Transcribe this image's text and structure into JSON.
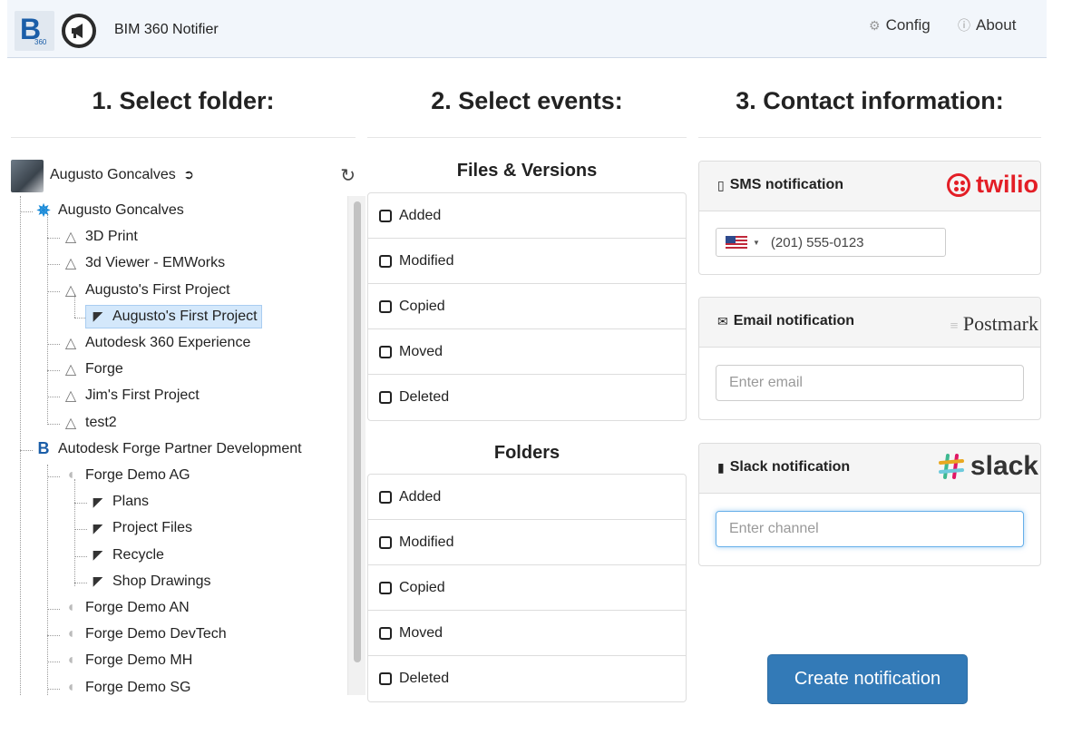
{
  "app": {
    "title": "BIM 360 Notifier",
    "logo_text": "B",
    "logo_sub": "360",
    "logo_icon": "megaphone-icon"
  },
  "nav": {
    "config_label": "Config",
    "about_label": "About"
  },
  "columns": {
    "folder_title": "1. Select folder:",
    "events_title": "2. Select events:",
    "contact_title": "3. Contact information:"
  },
  "user": {
    "name": "Augusto Goncalves"
  },
  "tree": {
    "items": [
      {
        "label": "Augusto Goncalves",
        "icon": "hub-icon",
        "level": 0
      },
      {
        "label": "3D Print",
        "icon": "project-icon",
        "level": 1
      },
      {
        "label": "3d Viewer - EMWorks",
        "icon": "project-icon",
        "level": 1
      },
      {
        "label": "Augusto's First Project",
        "icon": "project-icon",
        "level": 1
      },
      {
        "label": "Augusto's First Project",
        "icon": "folder-open-icon",
        "level": 2,
        "selected": true
      },
      {
        "label": "Autodesk 360 Experience",
        "icon": "project-icon",
        "level": 1
      },
      {
        "label": "Forge",
        "icon": "project-icon",
        "level": 1
      },
      {
        "label": "Jim's First Project",
        "icon": "project-icon",
        "level": 1
      },
      {
        "label": "test2",
        "icon": "project-icon",
        "level": 1
      },
      {
        "label": "Autodesk Forge Partner Development",
        "icon": "bim360-icon",
        "level": 0
      },
      {
        "label": "Forge Demo AG",
        "icon": "pin-icon",
        "level": 1
      },
      {
        "label": "Plans",
        "icon": "folder-open-icon",
        "level": 2
      },
      {
        "label": "Project Files",
        "icon": "folder-open-icon",
        "level": 2
      },
      {
        "label": "Recycle",
        "icon": "folder-open-icon",
        "level": 2
      },
      {
        "label": "Shop Drawings",
        "icon": "folder-open-icon",
        "level": 2
      },
      {
        "label": "Forge Demo AN",
        "icon": "pin-icon",
        "level": 1
      },
      {
        "label": "Forge Demo DevTech",
        "icon": "pin-icon",
        "level": 1
      },
      {
        "label": "Forge Demo MH",
        "icon": "pin-icon",
        "level": 1
      },
      {
        "label": "Forge Demo SG",
        "icon": "pin-icon",
        "level": 1
      }
    ]
  },
  "events": {
    "files_title": "Files & Versions",
    "files_items": [
      "Added",
      "Modified",
      "Copied",
      "Moved",
      "Deleted"
    ],
    "folders_title": "Folders",
    "folders_items": [
      "Added",
      "Modified",
      "Copied",
      "Moved",
      "Deleted"
    ]
  },
  "contact": {
    "sms": {
      "title": "SMS notification",
      "brand": "twilio",
      "phone_placeholder": "(201) 555-0123"
    },
    "email": {
      "title": "Email notification",
      "brand": "Postmark",
      "placeholder": "Enter email"
    },
    "slack": {
      "title": "Slack notification",
      "brand": "slack",
      "placeholder": "Enter channel"
    }
  },
  "actions": {
    "create_label": "Create notification"
  },
  "colors": {
    "primary": "#337ab7",
    "selected_bg": "#d4e8fb",
    "twilio": "#e31e26",
    "brand_blue": "#1b5ea8"
  }
}
